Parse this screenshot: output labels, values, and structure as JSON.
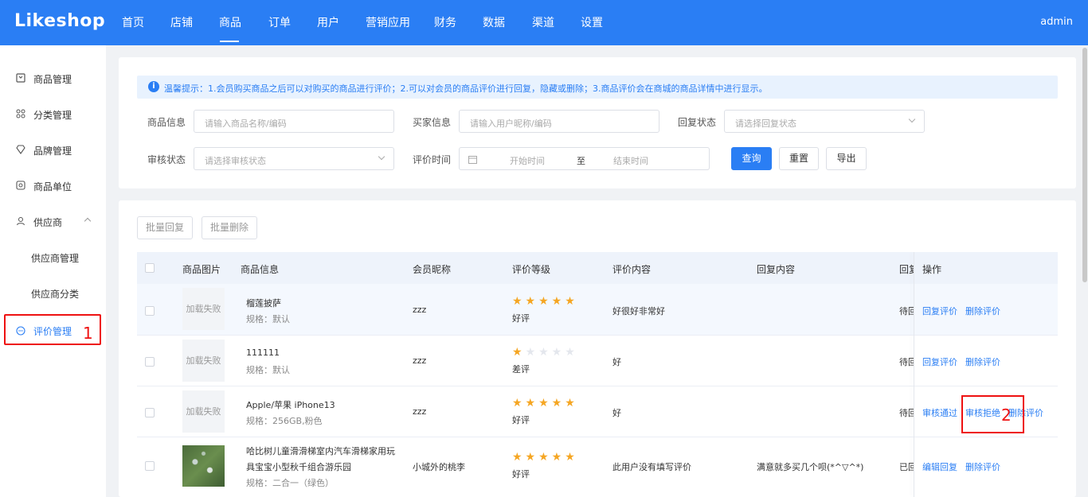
{
  "brand": {
    "logo": "Likeshop",
    "accent": "#2a7ef4"
  },
  "topnav": {
    "items": [
      "首页",
      "店铺",
      "商品",
      "订单",
      "用户",
      "营销应用",
      "财务",
      "数据",
      "渠道",
      "设置"
    ],
    "active": "商品",
    "user": "admin"
  },
  "sidebar": {
    "items": [
      {
        "label": "商品管理",
        "icon": "box-icon"
      },
      {
        "label": "分类管理",
        "icon": "category-icon"
      },
      {
        "label": "品牌管理",
        "icon": "brand-icon"
      },
      {
        "label": "商品单位",
        "icon": "unit-icon"
      },
      {
        "label": "供应商",
        "icon": "supplier-icon"
      }
    ],
    "sub_items": [
      "供应商管理",
      "供应商分类"
    ],
    "active": {
      "label": "评价管理",
      "icon": "comment-icon"
    }
  },
  "notice": "温馨提示：1.会员购买商品之后可以对购买的商品进行评价；2.可以对会员的商品评价进行回复，隐藏或删除；3.商品评价会在商城的商品详情中进行显示。",
  "filters": {
    "goods_label": "商品信息",
    "goods_placeholder": "请输入商品名称/编码",
    "buyer_label": "买家信息",
    "buyer_placeholder": "请输入用户昵称/编码",
    "reply_label": "回复状态",
    "reply_placeholder": "请选择回复状态",
    "audit_label": "审核状态",
    "audit_placeholder": "请选择审核状态",
    "time_label": "评价时间",
    "start_placeholder": "开始时间",
    "range_sep": "至",
    "end_placeholder": "结束时间",
    "query": "查询",
    "reset": "重置",
    "export": "导出"
  },
  "batch": {
    "reply": "批量回复",
    "delete": "批量删除"
  },
  "table": {
    "headers": [
      "商品图片",
      "商品信息",
      "会员昵称",
      "评价等级",
      "评价内容",
      "回复内容",
      "回复",
      "操作"
    ],
    "rows": [
      {
        "image": "加载失败",
        "name": "榴莲披萨",
        "spec": "规格：默认",
        "member": "zzz",
        "stars": 5,
        "grade": "好评",
        "content": "好很好非常好",
        "reply": "",
        "status": "待回",
        "ops": [
          "回复评价",
          "删除评价"
        ]
      },
      {
        "image": "加载失败",
        "name": "111111",
        "spec": "规格：默认",
        "member": "zzz",
        "stars": 1,
        "grade": "差评",
        "content": "好",
        "reply": "",
        "status": "待回",
        "ops": [
          "回复评价",
          "删除评价"
        ]
      },
      {
        "image": "加载失败",
        "name": "Apple/苹果 iPhone13",
        "spec": "规格：256GB,粉色",
        "member": "zzz",
        "stars": 5,
        "grade": "好评",
        "content": "好",
        "reply": "",
        "status": "待回",
        "ops": [
          "审核通过",
          "审核拒绝",
          "删除评价"
        ]
      },
      {
        "image": "",
        "name_line1": "哈比树儿童滑滑梯室内汽车滑梯家用玩",
        "name_line2": "具宝宝小型秋千组合游乐园",
        "spec": "规格：二合一（绿色）",
        "member": "小城外的桃李",
        "stars": 5,
        "grade": "好评",
        "content": "此用户没有填写评价",
        "reply": "满意就多买几个呗(*^▽^*)",
        "status": "已回",
        "ops": [
          "编辑回复",
          "删除评价"
        ]
      }
    ]
  },
  "markers": {
    "one": "1",
    "two": "2"
  }
}
